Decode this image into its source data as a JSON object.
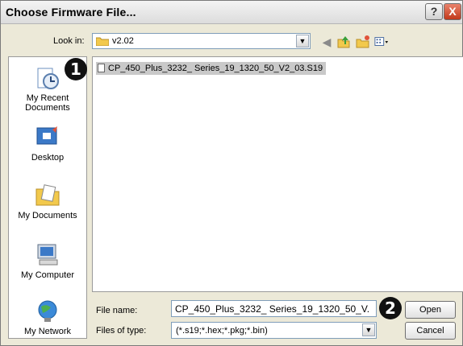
{
  "window": {
    "title": "Choose Firmware File...",
    "help_glyph": "?",
    "close_glyph": "X"
  },
  "look_in": {
    "label": "Look in:",
    "value": "v2.02"
  },
  "places": [
    {
      "label": "My Recent Documents"
    },
    {
      "label": "Desktop"
    },
    {
      "label": "My Documents"
    },
    {
      "label": "My Computer"
    },
    {
      "label": "My Network"
    }
  ],
  "files": [
    {
      "name": "CP_450_Plus_3232_ Series_19_1320_50_V2_03.S19",
      "selected": true
    }
  ],
  "file_name": {
    "label": "File name:",
    "value": "CP_450_Plus_3232_ Series_19_1320_50_V."
  },
  "file_type": {
    "label": "Files of type:",
    "value": "(*.s19;*.hex;*.pkg;*.bin)"
  },
  "buttons": {
    "open": "Open",
    "cancel": "Cancel"
  },
  "callouts": {
    "one": "1",
    "two": "2"
  },
  "colors": {
    "selection": "#c9c9c9",
    "folder": "#f2c94c",
    "close": "#c2391b"
  }
}
